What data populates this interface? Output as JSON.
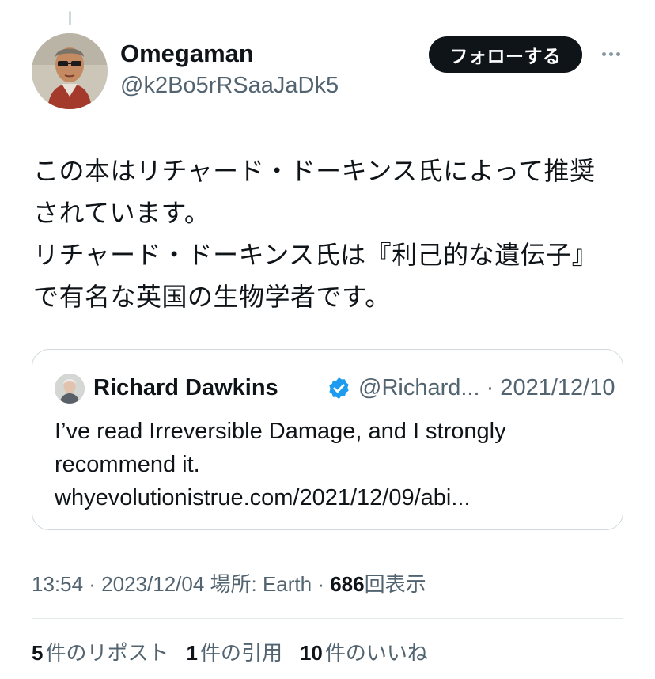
{
  "tweet": {
    "author": {
      "name": "Omegaman",
      "handle": "@k2Bo5rRSaaJaDk5"
    },
    "follow_label": "フォローする",
    "text_lines": [
      "この本はリチャード・ドーキンス氏によって推奨",
      "されています。",
      "リチャード・ドーキンス氏は『利己的な遺伝子』",
      "で有名な英国の生物学者です。"
    ],
    "quote": {
      "name": "Richard Dawkins",
      "handle_date": "@Richard... · 2021/12/10",
      "text_lines": [
        "I’ve read Irreversible Damage, and I strongly",
        "recommend it.",
        "whyevolutionistrue.com/2021/12/09/abi..."
      ]
    },
    "meta": {
      "time_date_place": "13:54 · 2023/12/04 場所: Earth · ",
      "views_count": "686",
      "views_label": "回表示"
    },
    "stats": {
      "reposts_count": "5",
      "reposts_label": "件のリポスト",
      "quotes_count": "1",
      "quotes_label": "件の引用",
      "likes_count": "10",
      "likes_label": "件のいいね"
    }
  },
  "colors": {
    "text_primary": "#0f1419",
    "text_secondary": "#536471",
    "border": "#cfd9de",
    "verified_blue": "#1d9bf0"
  },
  "icons": {
    "more": "more-horizontal-icon",
    "verified": "verified-badge-icon"
  }
}
